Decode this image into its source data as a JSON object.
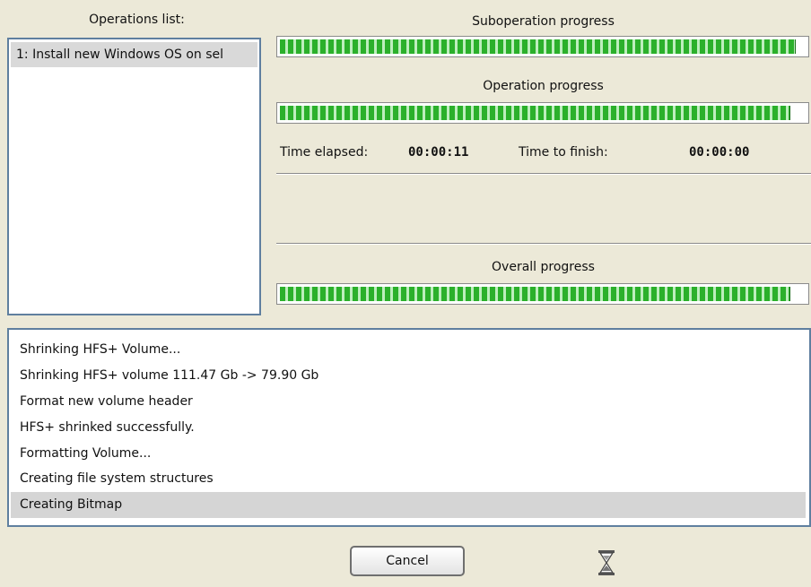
{
  "operations": {
    "label": "Operations list:",
    "items": [
      {
        "label": "1: Install new Windows OS on sel"
      }
    ]
  },
  "suboperation": {
    "label": "Suboperation progress",
    "progress_percent": 98
  },
  "operation": {
    "label": "Operation progress",
    "progress_percent": 97
  },
  "timing": {
    "elapsed_label": "Time elapsed:",
    "elapsed_value": "00:00:11",
    "finish_label": "Time to finish:",
    "finish_value": "00:00:00"
  },
  "overall": {
    "label": "Overall progress",
    "progress_percent": 97
  },
  "log": {
    "lines": [
      "Shrinking HFS+ Volume...",
      "Shrinking HFS+ volume 111.47 Gb -> 79.90 Gb",
      "Format new volume header",
      "HFS+ shrinked successfully.",
      "Formatting Volume...",
      "Creating file system structures",
      "Creating Bitmap"
    ],
    "selected_index": 6
  },
  "buttons": {
    "cancel": "Cancel"
  },
  "icons": {
    "busy": "hourglass-icon"
  },
  "colors": {
    "progress_green": "#2bb02b",
    "panel_border": "#5f7f9f",
    "background": "#ece9d8"
  }
}
